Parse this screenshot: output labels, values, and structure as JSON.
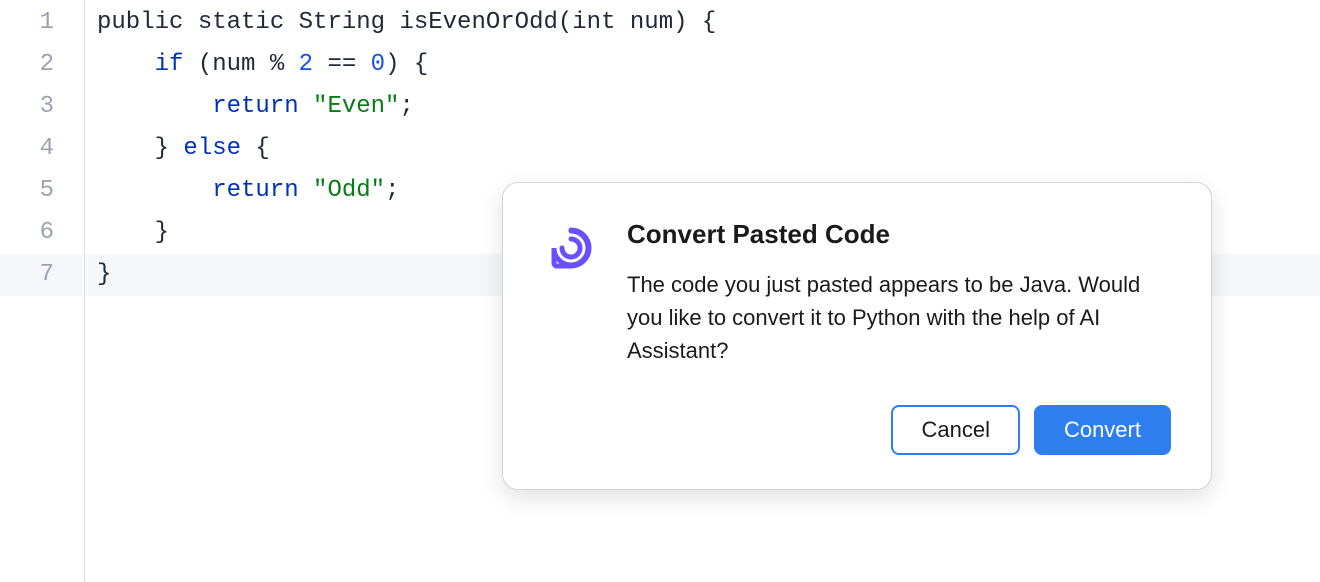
{
  "editor": {
    "line_numbers": [
      "1",
      "2",
      "3",
      "4",
      "5",
      "6",
      "7"
    ],
    "lines": [
      [
        {
          "t": "public static String isEvenOrOdd",
          "c": "tok-default"
        },
        {
          "t": "(",
          "c": "tok-paren"
        },
        {
          "t": "int num",
          "c": "tok-default"
        },
        {
          "t": ")",
          "c": "tok-paren"
        },
        {
          "t": " {",
          "c": "tok-default"
        }
      ],
      [
        {
          "t": "    ",
          "c": "tok-default"
        },
        {
          "t": "if",
          "c": "tok-keyword"
        },
        {
          "t": " ",
          "c": "tok-default"
        },
        {
          "t": "(",
          "c": "tok-paren"
        },
        {
          "t": "num % ",
          "c": "tok-default"
        },
        {
          "t": "2",
          "c": "tok-number"
        },
        {
          "t": " == ",
          "c": "tok-op"
        },
        {
          "t": "0",
          "c": "tok-number"
        },
        {
          "t": ")",
          "c": "tok-paren"
        },
        {
          "t": " {",
          "c": "tok-default"
        }
      ],
      [
        {
          "t": "        ",
          "c": "tok-default"
        },
        {
          "t": "return",
          "c": "tok-keyword"
        },
        {
          "t": " ",
          "c": "tok-default"
        },
        {
          "t": "\"Even\"",
          "c": "tok-string"
        },
        {
          "t": ";",
          "c": "tok-default"
        }
      ],
      [
        {
          "t": "    } ",
          "c": "tok-default"
        },
        {
          "t": "else",
          "c": "tok-keyword"
        },
        {
          "t": " {",
          "c": "tok-default"
        }
      ],
      [
        {
          "t": "        ",
          "c": "tok-default"
        },
        {
          "t": "return",
          "c": "tok-keyword"
        },
        {
          "t": " ",
          "c": "tok-default"
        },
        {
          "t": "\"Odd\"",
          "c": "tok-string"
        },
        {
          "t": ";",
          "c": "tok-default"
        }
      ],
      [
        {
          "t": "    }",
          "c": "tok-default"
        }
      ],
      [
        {
          "t": "}",
          "c": "tok-default"
        }
      ]
    ]
  },
  "dialog": {
    "title": "Convert Pasted Code",
    "body": "The code you just pasted appears to be Java. Would you like to convert it to Python with the help of AI Assistant?",
    "cancel_label": "Cancel",
    "convert_label": "Convert"
  }
}
